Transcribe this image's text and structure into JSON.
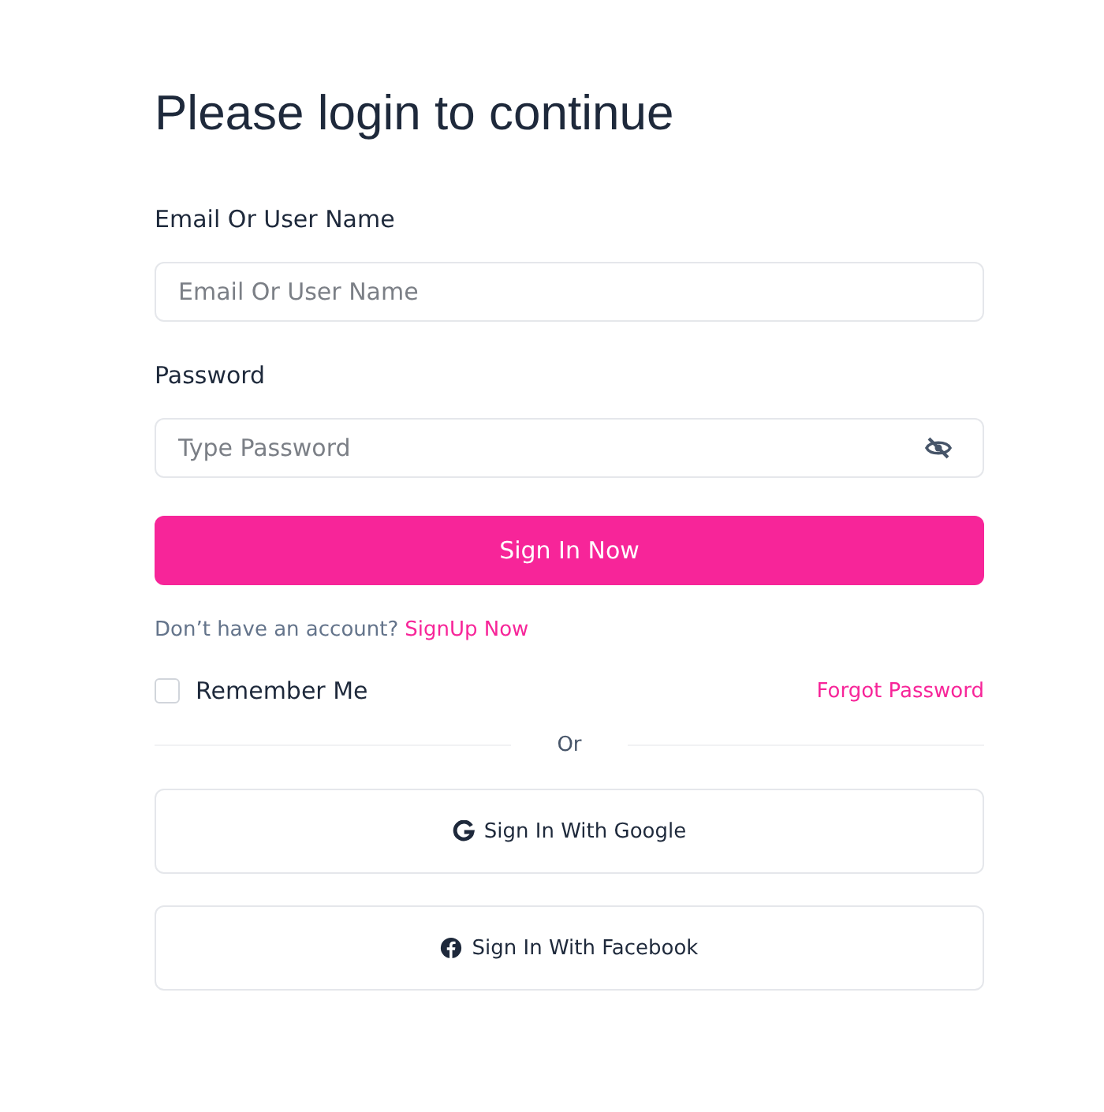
{
  "title": "Please login to continue",
  "fields": [
    {
      "label": "Email Or User Name",
      "placeholder": "Email Or User Name",
      "kind": "text"
    },
    {
      "label": "Password",
      "placeholder": "Type Password",
      "kind": "password"
    }
  ],
  "submit": "Sign In Now",
  "signup": {
    "prompt": "Don’t have an account?",
    "link": "SignUp Now"
  },
  "remember": {
    "label": "Remember Me",
    "checked": false
  },
  "forgot": "Forgot Password",
  "divider": "Or",
  "social": [
    {
      "label": "Sign In With Google",
      "kind": "google"
    },
    {
      "label": "Sign In With Facebook",
      "kind": "facebook"
    }
  ]
}
